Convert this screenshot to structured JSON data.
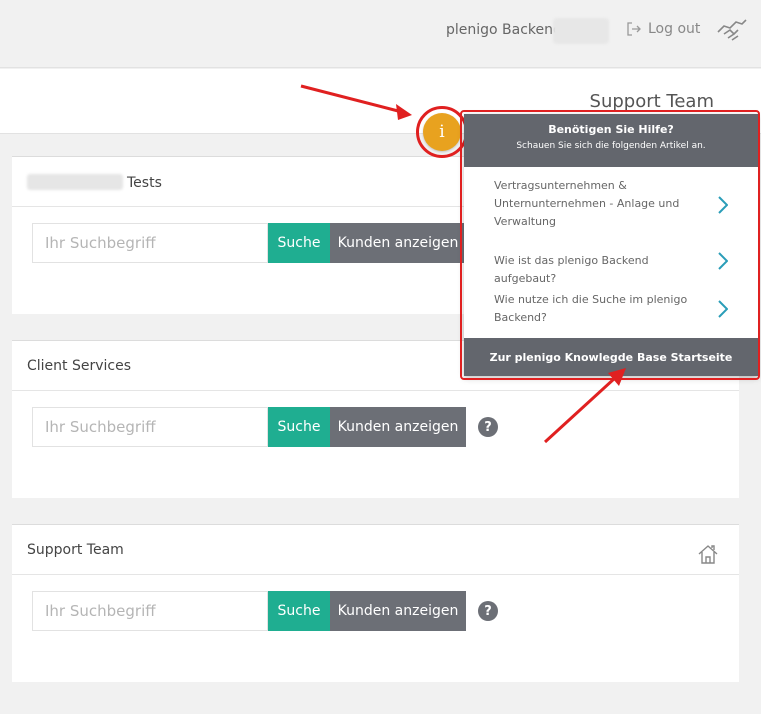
{
  "topbar": {
    "brand": "plenigo Backend",
    "logout_label": "Log out"
  },
  "subheader": {
    "title": "Support Team"
  },
  "search": {
    "placeholder": "Ihr Suchbegriff",
    "search_label": "Suche",
    "customers_label": "Kunden anzeigen",
    "help_glyph": "?"
  },
  "panels": [
    {
      "title": "Tests"
    },
    {
      "title": "Client Services"
    },
    {
      "title": "Support Team"
    }
  ],
  "info_button": {
    "glyph": "i"
  },
  "help_popup": {
    "title": "Benötigen Sie Hilfe?",
    "subtitle": "Schauen Sie sich die folgenden Artikel an.",
    "articles": [
      "Vertragsunternehmen & Unternunternehmen - Anlage und Verwaltung",
      "Wie ist das plenigo Backend aufgebaut?",
      "Wie nutze ich die Suche im plenigo Backend?"
    ],
    "footer_link": "Zur plenigo Knowlegde Base Startseite"
  },
  "colors": {
    "accent_green": "#1fae91",
    "gray_button": "#6c6f76",
    "info_orange": "#e8a21f",
    "annotation_red": "#e02020",
    "chevron_teal": "#2a9db8"
  }
}
